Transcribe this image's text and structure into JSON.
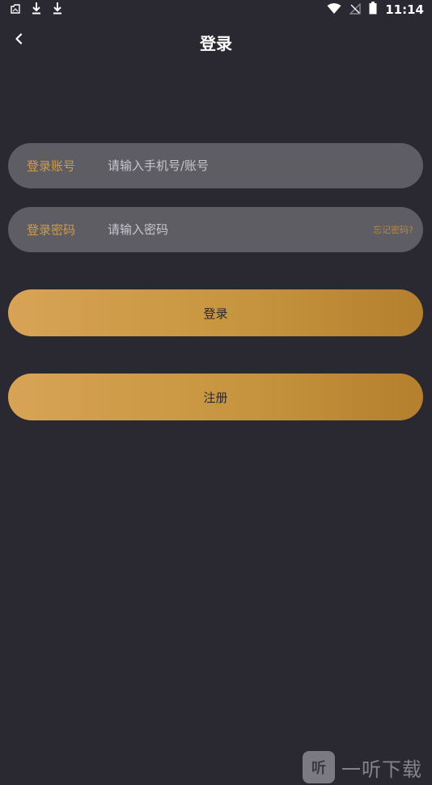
{
  "status_bar": {
    "time": "11:14"
  },
  "header": {
    "title": "登录"
  },
  "account_field": {
    "label": "登录账号",
    "placeholder": "请输入手机号/账号",
    "value": ""
  },
  "password_field": {
    "label": "登录密码",
    "placeholder": "请输入密码",
    "value": "",
    "forgot_label": "忘记密码?"
  },
  "buttons": {
    "login_label": "登录",
    "register_label": "注册"
  },
  "watermark": {
    "logo_glyph": "听",
    "text": "一听下载"
  },
  "colors": {
    "background": "#2a2830",
    "field_background": "#5e5d64",
    "accent": "#d19b46",
    "button_gradient_start": "#d8a356",
    "button_gradient_end": "#b57f2e"
  }
}
